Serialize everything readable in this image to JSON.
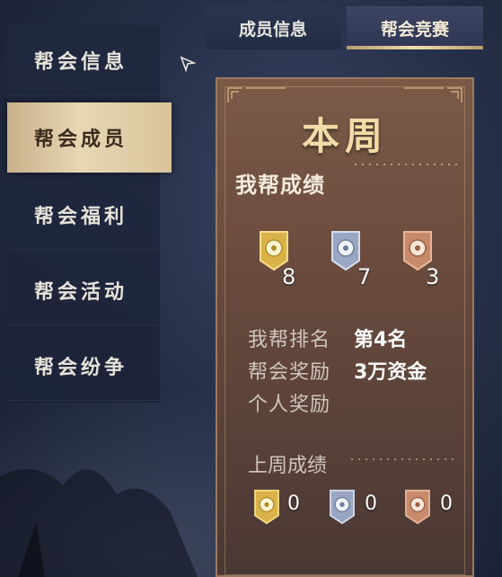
{
  "sidebar": {
    "items": [
      {
        "label": "帮会信息",
        "active": false
      },
      {
        "label": "帮会成员",
        "active": true
      },
      {
        "label": "帮会福利",
        "active": false
      },
      {
        "label": "帮会活动",
        "active": false
      },
      {
        "label": "帮会纷争",
        "active": false
      }
    ]
  },
  "tabs": [
    {
      "label": "成员信息",
      "active": false
    },
    {
      "label": "帮会竞赛",
      "active": true
    }
  ],
  "panel": {
    "title": "本周",
    "section_title": "我帮成绩",
    "medals": [
      {
        "tier": "gold",
        "count": "8",
        "color": "#d9b24a"
      },
      {
        "tier": "silver",
        "count": "7",
        "color": "#9aa7c2"
      },
      {
        "tier": "bronze",
        "count": "3",
        "color": "#c78a6a"
      }
    ],
    "rank_label": "我帮排名",
    "rank_value": "第4名",
    "reward_label": "帮会奖励",
    "reward_value": "3万资金",
    "personal_label": "个人奖励",
    "personal_value": "",
    "last_week_title": "上周成绩",
    "last_week_medals": [
      {
        "tier": "gold",
        "count": "0"
      },
      {
        "tier": "silver",
        "count": "0"
      },
      {
        "tier": "bronze",
        "count": "0"
      }
    ]
  },
  "colors": {
    "accent_gold": "#f1dca8",
    "panel_brown": "#6b4c3e",
    "sidebar_navy": "#202840",
    "active_item": "#e8d7b3"
  }
}
